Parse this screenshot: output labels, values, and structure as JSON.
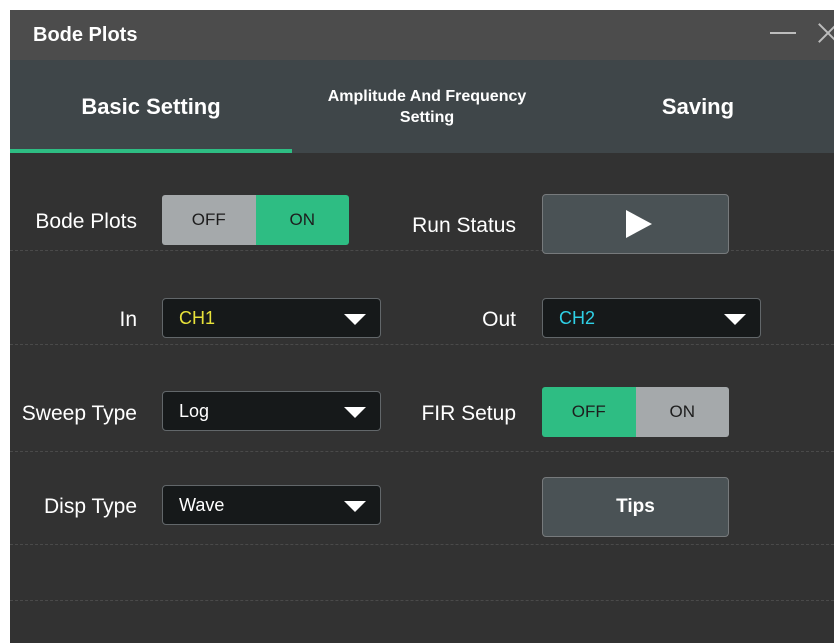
{
  "window": {
    "title": "Bode Plots"
  },
  "tabs": [
    {
      "label": "Basic Setting"
    },
    {
      "label_line1": "Amplitude And Frequency",
      "label_line2": "Setting"
    },
    {
      "label": "Saving"
    }
  ],
  "bode_plots": {
    "label": "Bode Plots",
    "off": "OFF",
    "on": "ON",
    "state": "ON"
  },
  "run_status": {
    "label": "Run Status",
    "icon": "play-icon"
  },
  "input": {
    "label": "In",
    "value": "CH1",
    "color": "#e8e23a"
  },
  "output": {
    "label": "Out",
    "value": "CH2",
    "color": "#2fd0e6"
  },
  "sweep_type": {
    "label": "Sweep Type",
    "value": "Log"
  },
  "fir_setup": {
    "label": "FIR Setup",
    "off": "OFF",
    "on": "ON",
    "state": "OFF"
  },
  "disp_type": {
    "label": "Disp Type",
    "value": "Wave"
  },
  "tips": {
    "label": "Tips"
  },
  "colors": {
    "accent": "#2ebd83",
    "panel": "#323232",
    "titlebar": "#4c4c4c",
    "tabbar": "#3f4649"
  }
}
